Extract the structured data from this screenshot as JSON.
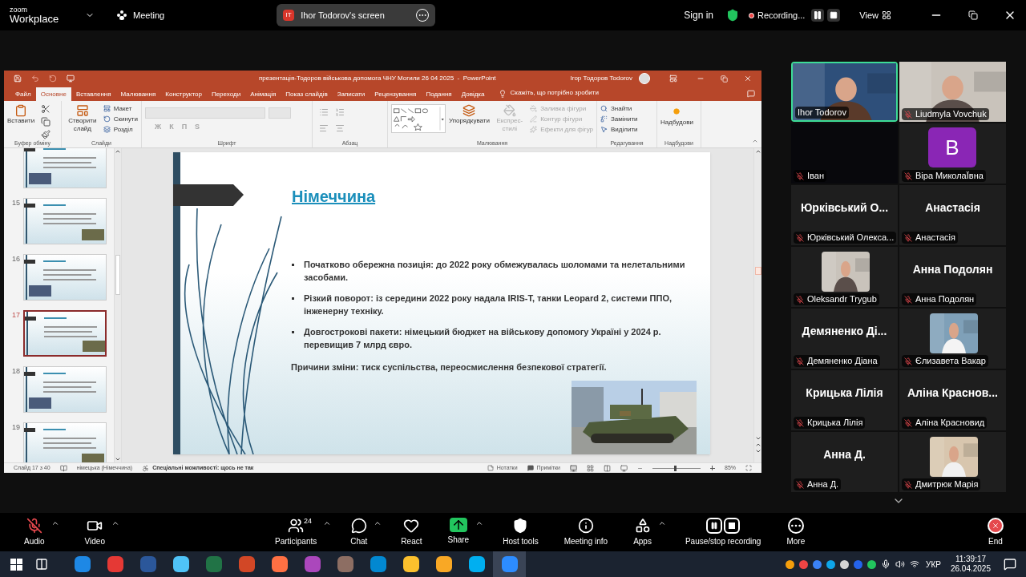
{
  "zoom_bar": {
    "brand_top": "zoom",
    "brand": "Workplace",
    "meeting": "Meeting",
    "share_badge": "IT",
    "share_label": "Ihor Todorov's screen",
    "sign_in": "Sign in",
    "recording": "Recording...",
    "view": "View"
  },
  "powerpoint": {
    "title": "презентація-Тодоров військова допомога ЧНУ Могили 26 04 2025  -  PowerPoint",
    "user": "Ігор Тодоров Todorov",
    "tabs": [
      {
        "label": "Файл",
        "selected": false
      },
      {
        "label": "Основне",
        "selected": true
      },
      {
        "label": "Вставлення",
        "selected": false
      },
      {
        "label": "Малювання",
        "selected": false
      },
      {
        "label": "Конструктор",
        "selected": false
      },
      {
        "label": "Переходи",
        "selected": false
      },
      {
        "label": "Анімація",
        "selected": false
      },
      {
        "label": "Показ слайдів",
        "selected": false
      },
      {
        "label": "Записати",
        "selected": false
      },
      {
        "label": "Рецензування",
        "selected": false
      },
      {
        "label": "Подання",
        "selected": false
      },
      {
        "label": "Довідка",
        "selected": false
      }
    ],
    "tell_me": "Скажіть, що потрібно зробити",
    "ribbon": [
      {
        "label": "Буфер обміну",
        "items": [
          {
            "label": "Вставити",
            "kind": "large",
            "disabled": false
          }
        ]
      },
      {
        "label": "Слайди",
        "items": [
          {
            "label": "Створити слайд",
            "kind": "large",
            "disabled": false
          },
          {
            "label": "Макет",
            "kind": "small",
            "disabled": false
          },
          {
            "label": "Скинути",
            "kind": "small",
            "disabled": false
          },
          {
            "label": "Розділ",
            "kind": "small",
            "disabled": false
          }
        ]
      },
      {
        "label": "Шрифт",
        "items": [
          {
            "label": "Ж",
            "kind": "glyph",
            "disabled": true
          },
          {
            "label": "К",
            "kind": "glyph",
            "disabled": true
          },
          {
            "label": "П",
            "kind": "glyph",
            "disabled": true
          },
          {
            "label": "S",
            "kind": "glyph",
            "disabled": true
          }
        ]
      },
      {
        "label": "Абзац"
      },
      {
        "label": "Малювання",
        "items": [
          {
            "label": "Упорядкувати",
            "kind": "large",
            "disabled": false
          },
          {
            "label": "Експрес-стилі",
            "kind": "large",
            "disabled": true
          },
          {
            "label": "Заливка фігури",
            "kind": "small",
            "disabled": true
          },
          {
            "label": "Контур фігури",
            "kind": "small",
            "disabled": true
          },
          {
            "label": "Ефекти для фігур",
            "kind": "small",
            "disabled": true
          }
        ]
      },
      {
        "label": "Редагування",
        "items": [
          {
            "label": "Знайти",
            "kind": "small",
            "disabled": false
          },
          {
            "label": "Замінити",
            "kind": "small",
            "disabled": false
          },
          {
            "label": "Виділити",
            "kind": "small",
            "disabled": false
          }
        ]
      },
      {
        "label": "Надбудови",
        "items": [
          {
            "label": "Надбудови",
            "kind": "large",
            "disabled": false
          }
        ]
      }
    ],
    "thumbnails": [
      {
        "selected": false
      },
      {
        "number": "15",
        "selected": false
      },
      {
        "number": "16",
        "selected": false
      },
      {
        "number": "17",
        "selected": true
      },
      {
        "number": "18",
        "selected": false
      },
      {
        "number": "19",
        "selected": false
      }
    ],
    "slide": {
      "title": "Німеччина",
      "bullets": [
        "Початково обережна позиція: до 2022 року обмежувалась шоломами та нелетальними засобами.",
        "Різкий поворот: із середини 2022 року надала IRIS-T, танки Leopard 2, системи ППО, інженерну техніку.",
        "Довгострокові пакети: німецький бюджет на військову допомогу Україні у 2024 р. перевищив 7 млрд євро."
      ],
      "conclusion": "Причини зміни: тиск суспільства, переосмислення безпекової стратегії."
    },
    "status_bar": {
      "slide_count": "Слайд 17 з 40",
      "language": "німецька (Німеччина)",
      "accessibility": "Спеціальні можливості: щось не так",
      "notes": "Нотатки",
      "comments": "Примітки",
      "zoom_slider": {
        "level": 0.45
      },
      "zoom": "85%"
    }
  },
  "participants": [
    {
      "name": "Ihor Todorov",
      "kind": "video",
      "muted": false,
      "active": true
    },
    {
      "name": "Liudmyla Vovchuk",
      "kind": "video",
      "muted": true,
      "active": false
    },
    {
      "name": "Іван",
      "kind": "blank",
      "muted": true,
      "active": false
    },
    {
      "name": "Віра МиколаЇвна",
      "kind": "avatar",
      "initial": "B",
      "muted": true,
      "active": false
    },
    {
      "name": "Юрківський Олекса...",
      "kind": "name",
      "display": "Юрківський О...",
      "muted": true,
      "active": false
    },
    {
      "name": "Анастасія",
      "kind": "name",
      "display": "Анастасія",
      "muted": true,
      "active": false
    },
    {
      "name": "Oleksandr Trygub",
      "muted": true,
      "active": false
    },
    {
      "name": "Анна Подолян",
      "kind": "name",
      "display": "Анна Подолян",
      "muted": true,
      "active": false
    },
    {
      "name": "Демяненко Діана",
      "kind": "name",
      "display": "Демяненко Ді...",
      "muted": true,
      "active": false
    },
    {
      "name": "Єлизавета Вакар",
      "muted": true,
      "active": false
    },
    {
      "name": "Крицька Лілія",
      "kind": "name",
      "display": "Крицька Лілія",
      "muted": true,
      "active": false
    },
    {
      "name": "Аліна Красновид",
      "kind": "name",
      "display": "Аліна Краснов...",
      "muted": true,
      "active": false
    },
    {
      "name": "Анна Д.",
      "kind": "name",
      "display": "Анна Д.",
      "muted": true,
      "active": false
    },
    {
      "name": "Дмитрюк Марія",
      "muted": true,
      "active": false
    }
  ],
  "toolbar": [
    {
      "label": "Audio",
      "kind": "audio",
      "muted": true,
      "caret": true
    },
    {
      "label": "Video",
      "kind": "video",
      "caret": true
    },
    {
      "label": "Participants",
      "kind": "participants",
      "badge": "24",
      "caret": true
    },
    {
      "label": "Chat",
      "kind": "chat",
      "caret": true
    },
    {
      "label": "React",
      "kind": "react",
      "caret": false
    },
    {
      "label": "Share",
      "kind": "share",
      "caret": true
    },
    {
      "label": "Host tools",
      "kind": "host",
      "caret": false
    },
    {
      "label": "Meeting info",
      "kind": "info",
      "caret": false
    },
    {
      "label": "Apps",
      "kind": "apps",
      "caret": true
    },
    {
      "label": "Pause/stop recording",
      "kind": "recording",
      "caret": false
    },
    {
      "label": "More",
      "kind": "more",
      "caret": false
    },
    {
      "label": "End",
      "kind": "end",
      "caret": false
    }
  ],
  "taskbar": {
    "apps": [
      {
        "color": "#1e88e5",
        "selected": false
      },
      {
        "color": "#e53935",
        "selected": false
      },
      {
        "color": "#2b579a",
        "selected": false
      },
      {
        "color": "#4fc3f7",
        "selected": false
      },
      {
        "color": "#217346",
        "selected": false
      },
      {
        "color": "#d24726",
        "selected": false
      },
      {
        "color": "#ff7043",
        "selected": false
      },
      {
        "color": "#ab47bc",
        "selected": false
      },
      {
        "color": "#8d6e63",
        "selected": false
      },
      {
        "color": "#0288d1",
        "selected": false
      },
      {
        "color": "#fbc02d",
        "selected": false
      },
      {
        "color": "#f9a825",
        "selected": false
      },
      {
        "color": "#00aff0",
        "selected": false
      },
      {
        "color": "#2d8cff",
        "selected": true
      }
    ],
    "language": "УКР",
    "time": "11:39:17",
    "date": "26.04.2025"
  }
}
